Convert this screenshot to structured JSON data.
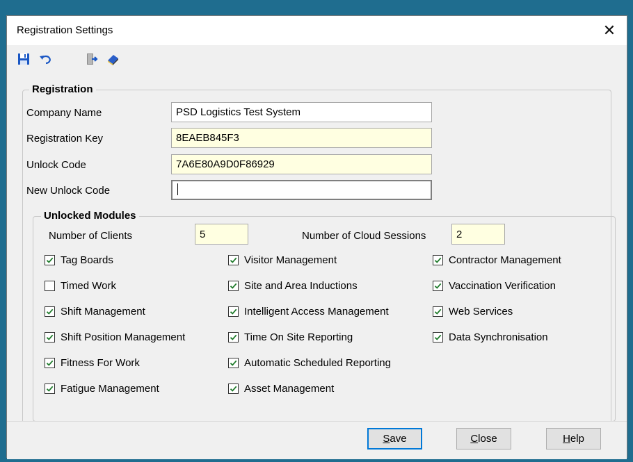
{
  "window": {
    "title": "Registration Settings",
    "close_glyph": "✕"
  },
  "toolbar": {
    "icons": [
      "save-icon",
      "undo-icon",
      "exit-icon",
      "help-book-icon"
    ],
    "colors": {
      "save": "#1a57c4",
      "undo": "#1a57c4"
    }
  },
  "registration": {
    "legend": "Registration",
    "company_name_label": "Company Name",
    "company_name_value": "PSD Logistics Test System",
    "registration_key_label": "Registration Key",
    "registration_key_value": "8EAEB845F3",
    "unlock_code_label": "Unlock Code",
    "unlock_code_value": "7A6E80A9D0F86929",
    "new_unlock_code_label": "New Unlock Code",
    "new_unlock_code_value": ""
  },
  "modules": {
    "legend": "Unlocked Modules",
    "clients_label": "Number of Clients",
    "clients_value": "5",
    "cloud_label": "Number of Cloud Sessions",
    "cloud_value": "2",
    "col1": [
      {
        "label": "Tag Boards",
        "checked": true
      },
      {
        "label": "Timed Work",
        "checked": false
      },
      {
        "label": "Shift Management",
        "checked": true
      },
      {
        "label": "Shift Position Management",
        "checked": true
      },
      {
        "label": "Fitness For Work",
        "checked": true
      },
      {
        "label": "Fatigue Management",
        "checked": true
      }
    ],
    "col2": [
      {
        "label": "Visitor Management",
        "checked": true
      },
      {
        "label": "Site and Area Inductions",
        "checked": true
      },
      {
        "label": "Intelligent Access Management",
        "checked": true
      },
      {
        "label": "Time On Site Reporting",
        "checked": true
      },
      {
        "label": "Automatic Scheduled Reporting",
        "checked": true
      },
      {
        "label": "Asset Management",
        "checked": true
      }
    ],
    "col3": [
      {
        "label": "Contractor Management",
        "checked": true
      },
      {
        "label": "Vaccination Verification",
        "checked": true
      },
      {
        "label": "Web Services",
        "checked": true
      },
      {
        "label": "Data Synchronisation",
        "checked": true
      }
    ]
  },
  "buttons": {
    "save_accel": "S",
    "save_rest": "ave",
    "close_accel": "C",
    "close_rest": "lose",
    "help_accel": "H",
    "help_rest": "elp"
  },
  "colors": {
    "window_bg": "#f0f0f0",
    "desktop": "#1f6d8f",
    "check": "#1e7a2a",
    "focus": "#0078d7",
    "readonly_field": "#ffffe1"
  }
}
